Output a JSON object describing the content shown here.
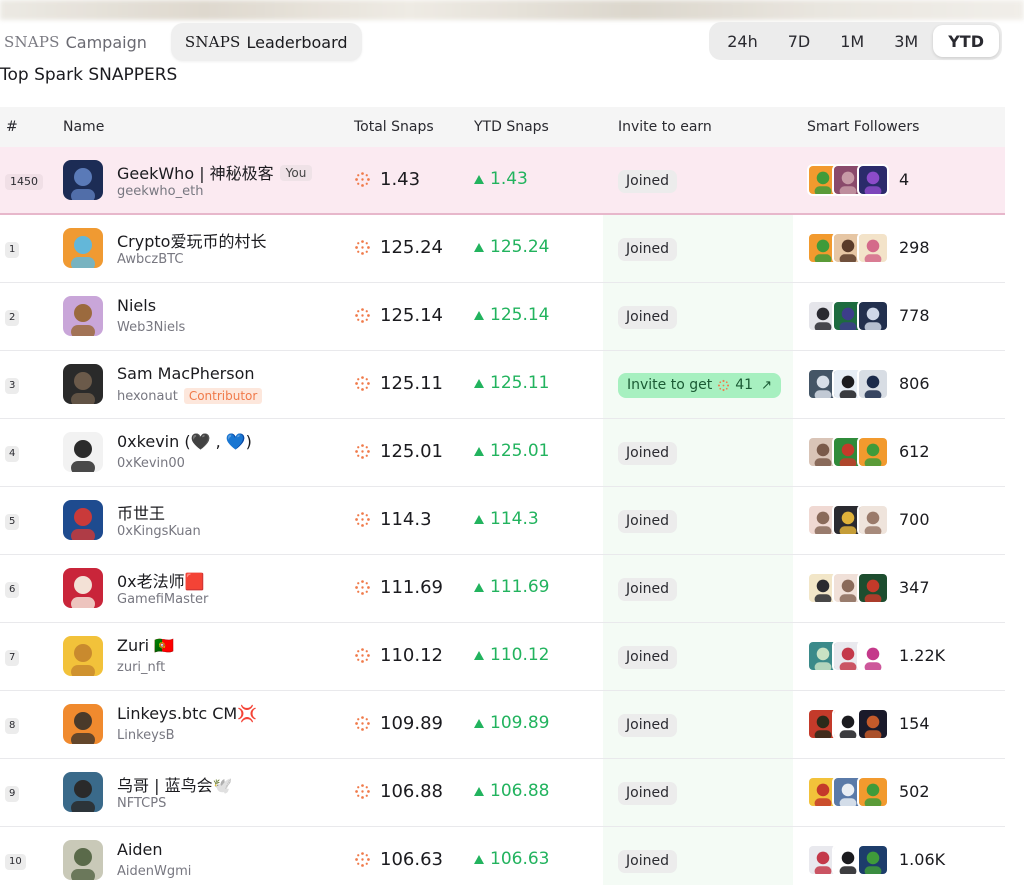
{
  "tabs": [
    {
      "brand": "SNAPS",
      "label": "Campaign",
      "active": false
    },
    {
      "brand": "SNAPS",
      "label": "Leaderboard",
      "active": true
    }
  ],
  "periods": [
    {
      "label": "24h",
      "active": false
    },
    {
      "label": "7D",
      "active": false
    },
    {
      "label": "1M",
      "active": false
    },
    {
      "label": "3M",
      "active": false
    },
    {
      "label": "YTD",
      "active": true
    }
  ],
  "subtitle": "Top Spark SNAPPERS",
  "columns": {
    "rank": "#",
    "name": "Name",
    "total": "Total Snaps",
    "ytd": "YTD Snaps",
    "invite": "Invite to earn",
    "followers": "Smart Followers"
  },
  "you_badge": "You",
  "contributor_badge": "Contributor",
  "invite": {
    "joined_label": "Joined",
    "invite_prefix": "Invite to get",
    "invite_amount": "41",
    "arrow": "↗"
  },
  "colors": {
    "accent_green": "#22b35e",
    "spark_orange": "#f07a4a",
    "you_row": "#fbeaf1",
    "invite_btn": "#a7f0c0"
  },
  "rows": [
    {
      "rank": "1450",
      "name": "GeekWho | 神秘极客",
      "handle": "geekwho_eth",
      "total": "1.43",
      "ytd": "1.43",
      "status": "Joined",
      "followers": "4",
      "you": true,
      "avatar": [
        "#1c2c55",
        "#5a7ab8"
      ],
      "favs": [
        [
          "#f29a2e",
          "#3f9b3a"
        ],
        [
          "#8a4a6b",
          "#c79aa6"
        ],
        [
          "#2b2b6b",
          "#8c4bc9"
        ]
      ]
    },
    {
      "rank": "1",
      "name": "Crypto爱玩币的村长",
      "handle": "AwbczBTC",
      "total": "125.24",
      "ytd": "125.24",
      "status": "Joined",
      "followers": "298",
      "avatar": [
        "#f09a32",
        "#63b7d9"
      ],
      "favs": [
        [
          "#f29a2e",
          "#3f9b3a"
        ],
        [
          "#e6c6a4",
          "#5a3b2a"
        ],
        [
          "#f3e3c9",
          "#d46a8a"
        ]
      ]
    },
    {
      "rank": "2",
      "name": "Niels",
      "handle": "Web3Niels",
      "total": "125.14",
      "ytd": "125.14",
      "status": "Joined",
      "followers": "778",
      "avatar": [
        "#c9a6d9",
        "#9b6a3e"
      ],
      "favs": [
        [
          "#e5e5ea",
          "#2a2a30"
        ],
        [
          "#1d6b3f",
          "#3d3d8a"
        ],
        [
          "#22304e",
          "#cfd8e8"
        ]
      ]
    },
    {
      "rank": "3",
      "name": "Sam MacPherson",
      "handle": "hexonaut",
      "total": "125.11",
      "ytd": "125.11",
      "status": "invite",
      "followers": "806",
      "contributor": true,
      "avatar": [
        "#2a2a2a",
        "#6b5a4a"
      ],
      "favs": [
        [
          "#445566",
          "#d7dee8"
        ],
        [
          "#e6edf5",
          "#1b1b1f"
        ],
        [
          "#d8dde4",
          "#1b2a4a"
        ]
      ]
    },
    {
      "rank": "4",
      "name": "0xkevin (🖤 , 💙)",
      "handle": "0xKevin00",
      "total": "125.01",
      "ytd": "125.01",
      "status": "Joined",
      "followers": "612",
      "avatar": [
        "#f2f2f2",
        "#2b2b2b"
      ],
      "favs": [
        [
          "#d9c4b7",
          "#7a5a4a"
        ],
        [
          "#2f8b3a",
          "#c43a2a"
        ],
        [
          "#f29a2e",
          "#3f9b3a"
        ]
      ]
    },
    {
      "rank": "5",
      "name": "币世王",
      "handle": "0xKingsKuan",
      "total": "114.3",
      "ytd": "114.3",
      "status": "Joined",
      "followers": "700",
      "avatar": [
        "#1e4b8f",
        "#c93a3a"
      ],
      "favs": [
        [
          "#f0d9d3",
          "#8a6a5a"
        ],
        [
          "#2a2a30",
          "#e0b23a"
        ],
        [
          "#efe4dc",
          "#9a7a6a"
        ]
      ]
    },
    {
      "rank": "6",
      "name": "0x老法师🟥",
      "handle": "GamefiMaster",
      "total": "111.69",
      "ytd": "111.69",
      "status": "Joined",
      "followers": "347",
      "avatar": [
        "#c9253a",
        "#f3e1d6"
      ],
      "favs": [
        [
          "#f2e6c8",
          "#2a2a30"
        ],
        [
          "#f0e0d8",
          "#8a6a5a"
        ],
        [
          "#1d4d2f",
          "#c43a2a"
        ]
      ]
    },
    {
      "rank": "7",
      "name": "Zuri 🇵🇹",
      "handle": "zuri_nft",
      "total": "110.12",
      "ytd": "110.12",
      "status": "Joined",
      "followers": "1.22K",
      "avatar": [
        "#f2c23a",
        "#c98a2e"
      ],
      "favs": [
        [
          "#3b8a8a",
          "#c9e2c4"
        ],
        [
          "#e9e9ee",
          "#c4394a"
        ],
        [
          "#ffffff",
          "#c4398a"
        ]
      ]
    },
    {
      "rank": "8",
      "name": "Linkeys.btc CM💢",
      "handle": "LinkeysB",
      "total": "109.89",
      "ytd": "109.89",
      "status": "Joined",
      "followers": "154",
      "avatar": [
        "#f08a2e",
        "#4a3a2a"
      ],
      "favs": [
        [
          "#c43a2a",
          "#2a2a1a"
        ],
        [
          "#ffffff",
          "#1b1b1f"
        ],
        [
          "#1a1a2a",
          "#c45a2a"
        ]
      ]
    },
    {
      "rank": "9",
      "name": "乌哥 | 蓝鸟会🕊️",
      "handle": "NFTCPS",
      "total": "106.88",
      "ytd": "106.88",
      "status": "Joined",
      "followers": "502",
      "avatar": [
        "#3a6a8a",
        "#2a2a2a"
      ],
      "favs": [
        [
          "#f2c23a",
          "#c4392a"
        ],
        [
          "#5a7aa8",
          "#e9eef4"
        ],
        [
          "#f29a2e",
          "#3f9b3a"
        ]
      ]
    },
    {
      "rank": "10",
      "name": "Aiden",
      "handle": "AidenWgmi",
      "total": "106.63",
      "ytd": "106.63",
      "status": "Joined",
      "followers": "1.06K",
      "avatar": [
        "#c9c9b8",
        "#5a6a4a"
      ],
      "favs": [
        [
          "#e9e9ee",
          "#c4394a"
        ],
        [
          "#ffffff",
          "#1b1b1f"
        ],
        [
          "#1d3d6b",
          "#3f9b3a"
        ]
      ]
    }
  ]
}
